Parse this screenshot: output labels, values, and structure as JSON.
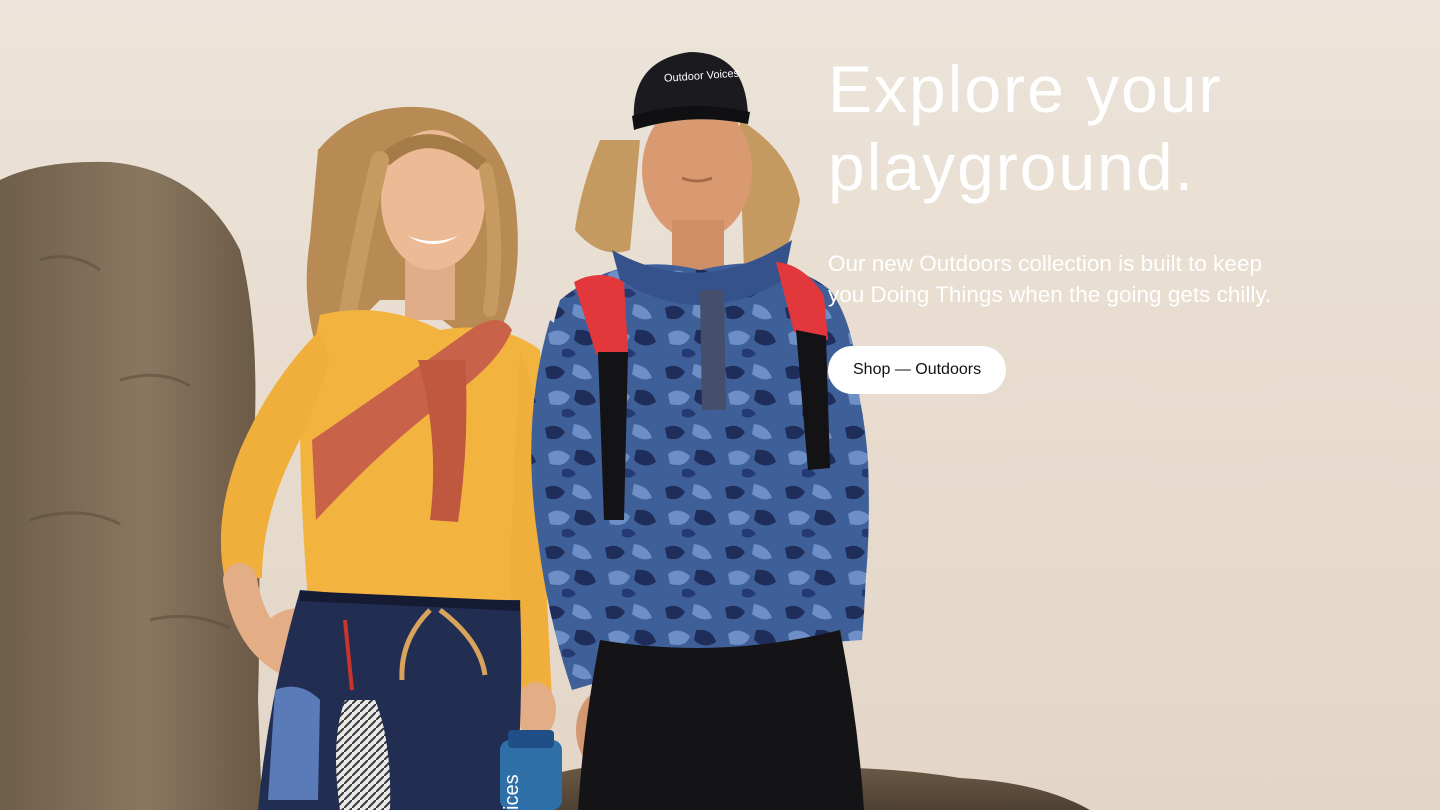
{
  "hero": {
    "headline_line1": "Explore your",
    "headline_line2": "playground.",
    "subcopy_line1": "Our new Outdoors collection is built to keep",
    "subcopy_line2": "you Doing Things when the going gets chilly.",
    "cta_label": "Shop — Outdoors",
    "cap_logo_text": "Outdoor Voices",
    "bottle_text": "ices"
  },
  "colors": {
    "background": "#e8ddd0",
    "headline_text": "#ffffff",
    "cta_background": "#ffffff",
    "cta_text": "#111111",
    "rock": "#7d6b55",
    "yellow_top": "#f0b43c",
    "rust_sweater": "#c6654b",
    "camo_fleece": "#3d5f98",
    "black_cap": "#1b1b1f"
  }
}
